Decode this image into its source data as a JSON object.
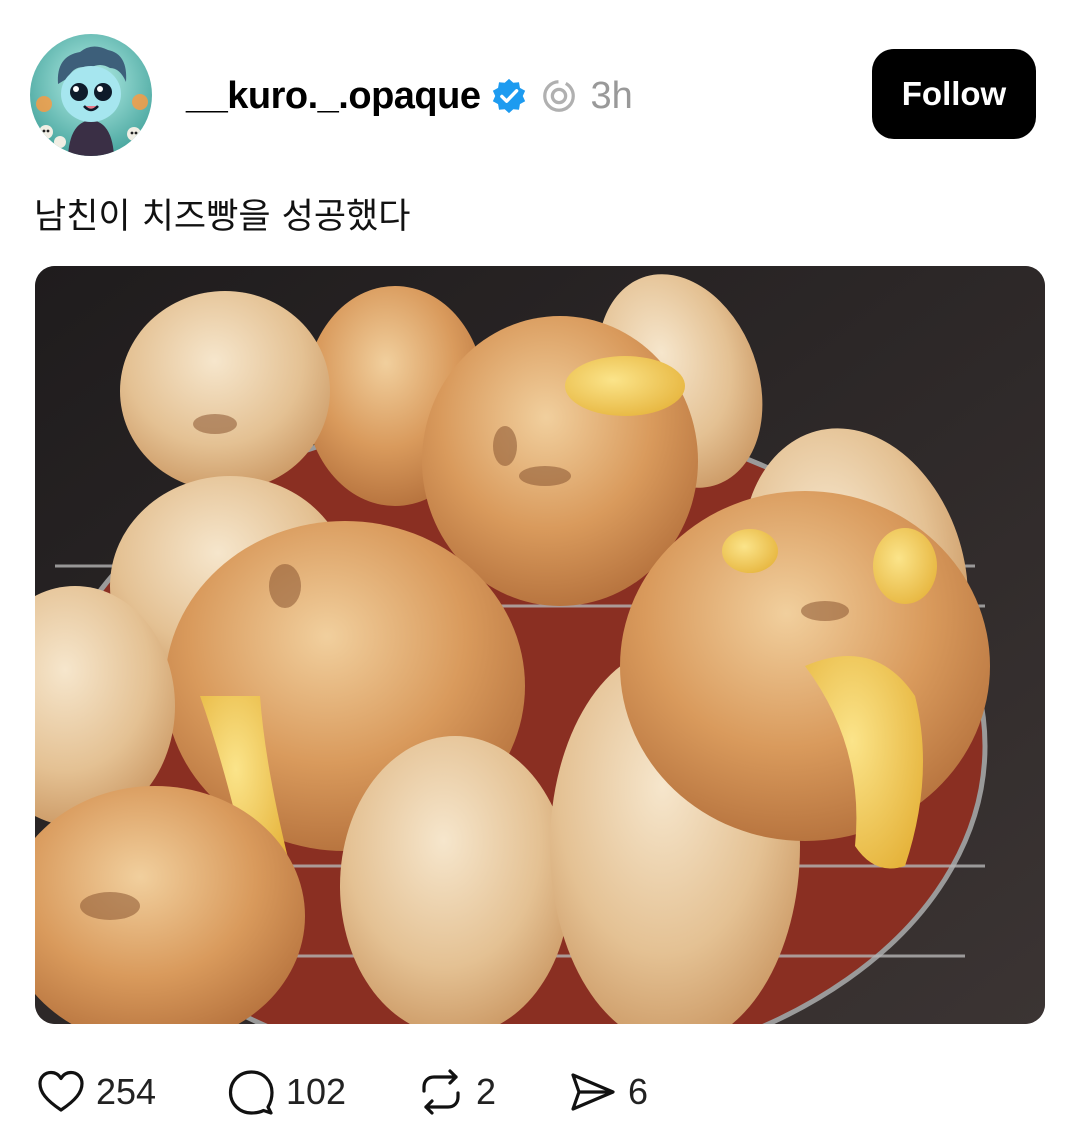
{
  "post": {
    "username": "__kuro._.opaque",
    "time": "3h",
    "follow_label": "Follow",
    "caption": "남친이 치즈빵을 성공했다",
    "image_icon": "photo-of-cheese-bread-rolls"
  },
  "actions": {
    "likes": "254",
    "replies": "102",
    "reposts": "2",
    "shares": "6"
  },
  "icons": {
    "verified": "verified-badge-icon",
    "activity": "activity-ring-icon",
    "like": "heart-icon",
    "reply": "speech-bubble-icon",
    "repost": "repost-arrows-icon",
    "share": "send-arrow-icon"
  },
  "colors": {
    "verified_blue": "#1d9bf0",
    "follow_bg": "#000000",
    "follow_text": "#ffffff",
    "muted_gray": "#999999"
  }
}
